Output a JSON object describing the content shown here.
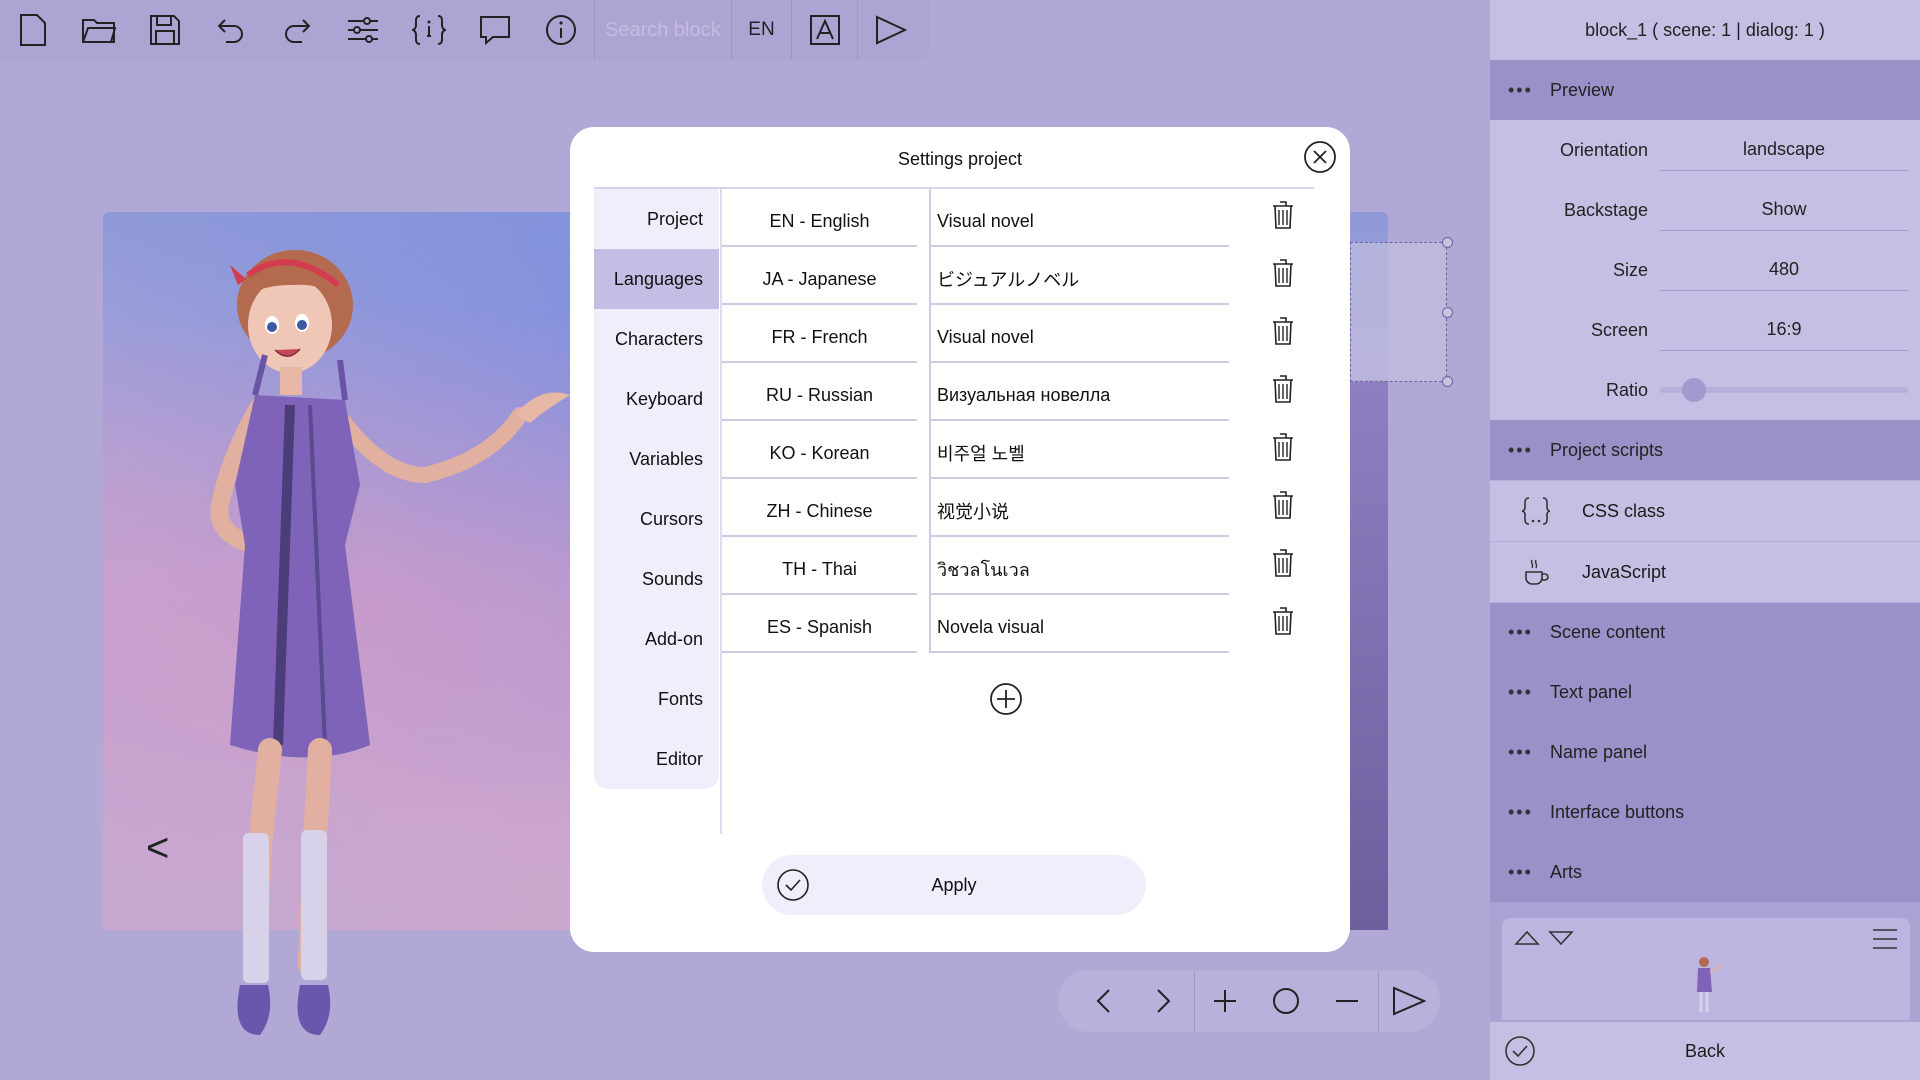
{
  "toolbar": {
    "icons": [
      "new-file-icon",
      "open-folder-icon",
      "save-icon",
      "undo-icon",
      "redo-icon",
      "settings-sliders-icon",
      "variables-braces-icon",
      "dialog-bubble-icon",
      "info-icon"
    ],
    "search_placeholder": "Search block",
    "language": "EN",
    "extra_icons": [
      "font-icon",
      "play-icon"
    ]
  },
  "stage": {
    "back_arrow": "<"
  },
  "playback": {
    "icons": [
      "previous-icon",
      "next-icon",
      "add-icon",
      "circle-icon",
      "remove-icon",
      "play-icon"
    ]
  },
  "right_panel": {
    "header": "block_1 ( scene: 1 | dialog: 1 )",
    "preview": {
      "label": "Preview",
      "orientation": {
        "label": "Orientation",
        "value": "landscape"
      },
      "backstage": {
        "label": "Backstage",
        "value": "Show"
      },
      "size": {
        "label": "Size",
        "value": "480"
      },
      "screen": {
        "label": "Screen",
        "value": "16:9"
      },
      "ratio": {
        "label": "Ratio",
        "level": 0.1
      }
    },
    "project_scripts": {
      "label": "Project scripts",
      "css_label": "CSS class",
      "js_label": "JavaScript"
    },
    "sections": [
      "Scene content",
      "Text panel",
      "Name panel",
      "Interface buttons",
      "Arts"
    ],
    "back_label": "Back"
  },
  "modal": {
    "title": "Settings project",
    "nav": [
      "Project",
      "Languages",
      "Characters",
      "Keyboard",
      "Variables",
      "Cursors",
      "Sounds",
      "Add-on",
      "Fonts",
      "Editor"
    ],
    "active_nav": "Languages",
    "languages": [
      {
        "code": "EN - English",
        "name": "Visual novel"
      },
      {
        "code": "JA - Japanese",
        "name": "ビジュアルノベル"
      },
      {
        "code": "FR - French",
        "name": "Visual novel"
      },
      {
        "code": "RU - Russian",
        "name": "Визуальная новелла"
      },
      {
        "code": "KO - Korean",
        "name": "비주얼 노벨"
      },
      {
        "code": "ZH - Chinese",
        "name": "视觉小说"
      },
      {
        "code": "TH - Thai",
        "name": "วิชวลโนเวล"
      },
      {
        "code": "ES - Spanish",
        "name": "Novela visual"
      }
    ],
    "apply_label": "Apply"
  }
}
